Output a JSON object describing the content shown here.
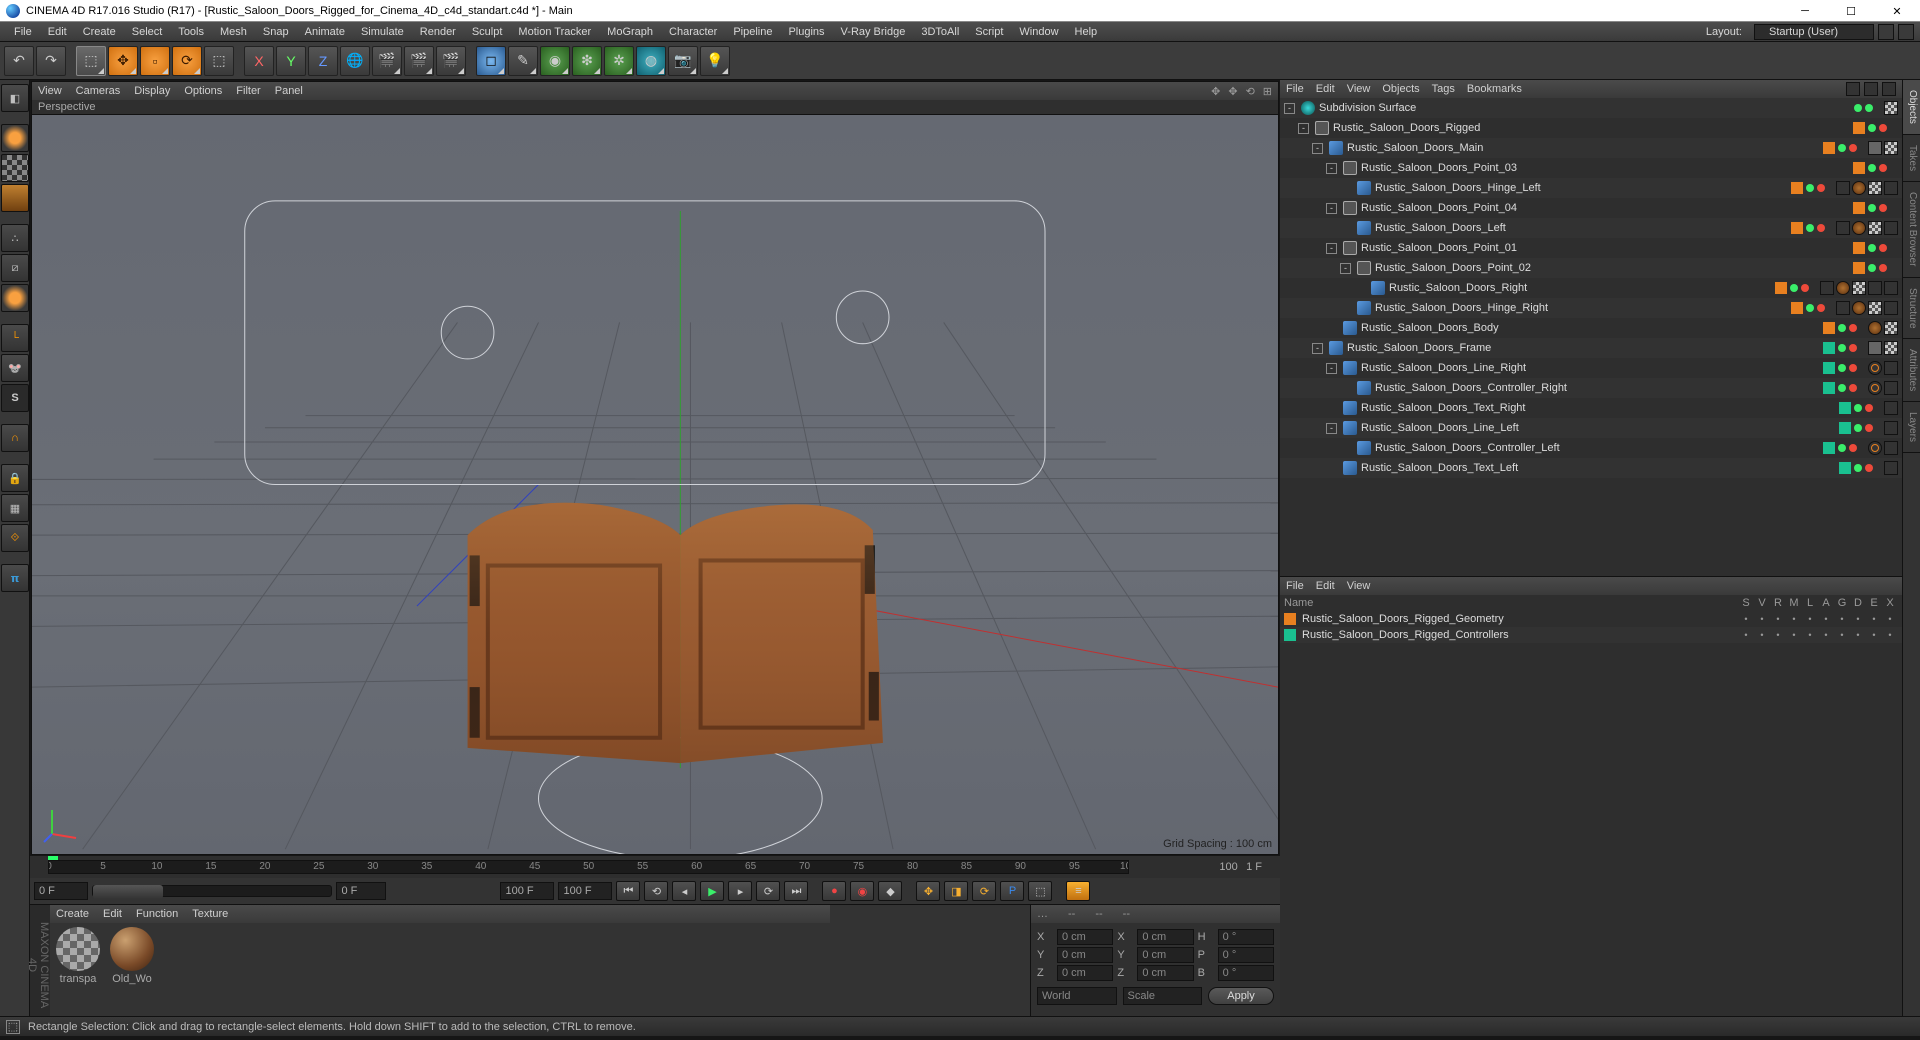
{
  "titlebar": {
    "text": "CINEMA 4D R17.016 Studio (R17) - [Rustic_Saloon_Doors_Rigged_for_Cinema_4D_c4d_standart.c4d *] - Main"
  },
  "menubar": {
    "items": [
      "File",
      "Edit",
      "Create",
      "Select",
      "Tools",
      "Mesh",
      "Snap",
      "Animate",
      "Simulate",
      "Render",
      "Sculpt",
      "Motion Tracker",
      "MoGraph",
      "Character",
      "Pipeline",
      "Plugins",
      "V-Ray Bridge",
      "3DToAll",
      "Script",
      "Window",
      "Help"
    ],
    "layout_label": "Layout:",
    "layout_value": "Startup (User)"
  },
  "viewport": {
    "menus": [
      "View",
      "Cameras",
      "Display",
      "Options",
      "Filter",
      "Panel"
    ],
    "label": "Perspective",
    "grid_info": "Grid Spacing : 100 cm"
  },
  "timeline": {
    "ticks": [
      0,
      5,
      10,
      15,
      20,
      25,
      30,
      35,
      40,
      45,
      50,
      55,
      60,
      65,
      70,
      75,
      80,
      85,
      90,
      95,
      100
    ],
    "frames_label": "1 F",
    "start": "0 F",
    "cur": "0 F",
    "len": "100 F",
    "len2": "100 F"
  },
  "materials": {
    "menus": [
      "Create",
      "Edit",
      "Function",
      "Texture"
    ],
    "items": [
      {
        "name": "transpa",
        "kind": "transp"
      },
      {
        "name": "Old_Wo",
        "kind": "wood"
      }
    ]
  },
  "coords": {
    "head": [
      "…",
      "--",
      "--",
      "--"
    ],
    "rows": [
      {
        "l": "X",
        "v1": "0 cm",
        "m": "X",
        "v2": "0 cm",
        "r": "H",
        "v3": "0 °"
      },
      {
        "l": "Y",
        "v1": "0 cm",
        "m": "Y",
        "v2": "0 cm",
        "r": "P",
        "v3": "0 °"
      },
      {
        "l": "Z",
        "v1": "0 cm",
        "m": "Z",
        "v2": "0 cm",
        "r": "B",
        "v3": "0 °"
      }
    ],
    "sel1": "World",
    "sel2": "Scale",
    "apply": "Apply"
  },
  "objpanel": {
    "menus": [
      "File",
      "Edit",
      "View",
      "Objects",
      "Tags",
      "Bookmarks"
    ]
  },
  "objects": [
    {
      "d": 0,
      "tog": "-",
      "icon": "subdiv",
      "name": "Subdivision Surface",
      "sw": "",
      "tags": [
        "checker"
      ],
      "vis": "gg"
    },
    {
      "d": 1,
      "tog": "-",
      "icon": "null",
      "name": "Rustic_Saloon_Doors_Rigged",
      "sw": "orange",
      "tags": [],
      "vis": "gr"
    },
    {
      "d": 2,
      "tog": "-",
      "icon": "poly",
      "name": "Rustic_Saloon_Doors_Main",
      "sw": "orange",
      "tags": [
        "gray",
        "checker"
      ],
      "vis": "gr"
    },
    {
      "d": 3,
      "tog": "-",
      "icon": "null",
      "name": "Rustic_Saloon_Doors_Point_03",
      "sw": "orange",
      "tags": [],
      "vis": "gr"
    },
    {
      "d": 4,
      "tog": "",
      "icon": "poly",
      "name": "Rustic_Saloon_Doors_Hinge_Left",
      "sw": "orange",
      "tags": [
        "dots",
        "wood",
        "checker",
        "xp"
      ],
      "vis": "gr"
    },
    {
      "d": 3,
      "tog": "-",
      "icon": "null",
      "name": "Rustic_Saloon_Doors_Point_04",
      "sw": "orange",
      "tags": [],
      "vis": "gr"
    },
    {
      "d": 4,
      "tog": "",
      "icon": "poly",
      "name": "Rustic_Saloon_Doors_Left",
      "sw": "orange",
      "tags": [
        "dots",
        "wood",
        "checker",
        "xp"
      ],
      "vis": "gr"
    },
    {
      "d": 3,
      "tog": "-",
      "icon": "null",
      "name": "Rustic_Saloon_Doors_Point_01",
      "sw": "orange",
      "tags": [],
      "vis": "gr"
    },
    {
      "d": 4,
      "tog": "-",
      "icon": "null",
      "name": "Rustic_Saloon_Doors_Point_02",
      "sw": "orange",
      "tags": [],
      "vis": "gr"
    },
    {
      "d": 5,
      "tog": "",
      "icon": "poly",
      "name": "Rustic_Saloon_Doors_Right",
      "sw": "orange",
      "tags": [
        "dots",
        "wood",
        "checker",
        "xp",
        "xp"
      ],
      "vis": "gr"
    },
    {
      "d": 4,
      "tog": "",
      "icon": "poly",
      "name": "Rustic_Saloon_Doors_Hinge_Right",
      "sw": "orange",
      "tags": [
        "dots",
        "wood",
        "checker",
        "xp"
      ],
      "vis": "gr"
    },
    {
      "d": 3,
      "tog": "",
      "icon": "poly",
      "name": "Rustic_Saloon_Doors_Body",
      "sw": "orange",
      "tags": [
        "wood",
        "checker"
      ],
      "vis": "gr"
    },
    {
      "d": 2,
      "tog": "-",
      "icon": "poly",
      "name": "Rustic_Saloon_Doors_Frame",
      "sw": "teal",
      "tags": [
        "gray",
        "checker"
      ],
      "vis": "gr"
    },
    {
      "d": 3,
      "tog": "-",
      "icon": "poly",
      "name": "Rustic_Saloon_Doors_Line_Right",
      "sw": "teal",
      "tags": [
        "nosym",
        "xp"
      ],
      "vis": "gr"
    },
    {
      "d": 4,
      "tog": "",
      "icon": "poly",
      "name": "Rustic_Saloon_Doors_Controller_Right",
      "sw": "teal",
      "tags": [
        "nosym",
        "xp"
      ],
      "vis": "gr"
    },
    {
      "d": 3,
      "tog": "",
      "icon": "poly",
      "name": "Rustic_Saloon_Doors_Text_Right",
      "sw": "teal",
      "tags": [
        "xp"
      ],
      "vis": "gr"
    },
    {
      "d": 3,
      "tog": "-",
      "icon": "poly",
      "name": "Rustic_Saloon_Doors_Line_Left",
      "sw": "teal",
      "tags": [
        "xp"
      ],
      "vis": "gr"
    },
    {
      "d": 4,
      "tog": "",
      "icon": "poly",
      "name": "Rustic_Saloon_Doors_Controller_Left",
      "sw": "teal",
      "tags": [
        "nosym",
        "xp"
      ],
      "vis": "gr"
    },
    {
      "d": 3,
      "tog": "",
      "icon": "poly",
      "name": "Rustic_Saloon_Doors_Text_Left",
      "sw": "teal",
      "tags": [
        "xp"
      ],
      "vis": "gr"
    }
  ],
  "layerpanel": {
    "menus": [
      "File",
      "Edit",
      "View"
    ],
    "cols": [
      "Name",
      "S",
      "V",
      "R",
      "M",
      "L",
      "A",
      "G",
      "D",
      "E",
      "X"
    ],
    "rows": [
      {
        "sw": "orange",
        "name": "Rustic_Saloon_Doors_Rigged_Geometry"
      },
      {
        "sw": "teal",
        "name": "Rustic_Saloon_Doors_Rigged_Controllers"
      }
    ]
  },
  "right_tabs": [
    "Objects",
    "Takes",
    "Content Browser",
    "Structure"
  ],
  "right_tabs2": [
    "Attributes",
    "Layers"
  ],
  "statusbar": {
    "text": "Rectangle Selection: Click and drag to rectangle-select elements. Hold down SHIFT to add to the selection, CTRL to remove."
  },
  "maxon": "MAXON  CINEMA 4D"
}
